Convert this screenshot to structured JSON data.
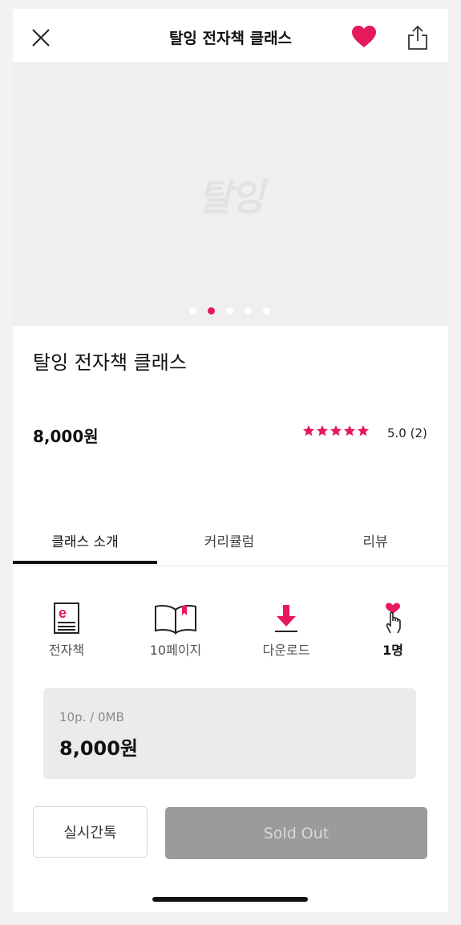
{
  "header": {
    "title": "탈잉 전자책 클래스",
    "close_icon": "close-icon",
    "like_icon": "heart-icon",
    "share_icon": "share-icon",
    "like_color": "#e6195b"
  },
  "hero": {
    "logo_text": "탈잉",
    "carousel_total": 5,
    "carousel_active": 2
  },
  "product": {
    "title": "탈잉 전자책 클래스",
    "price": "8,000원",
    "rating_stars": 5,
    "rating_text": "5.0 (2)",
    "star_color": "#e6195b"
  },
  "tabs": [
    {
      "label": "클래스 소개",
      "active": true
    },
    {
      "label": "커리큘럼",
      "active": false
    },
    {
      "label": "리뷰",
      "active": false
    }
  ],
  "features": [
    {
      "icon": "ebook-icon",
      "label": "전자책"
    },
    {
      "icon": "book-open-icon",
      "label": "10페이지"
    },
    {
      "icon": "download-icon",
      "label": "다운로드"
    },
    {
      "icon": "heart-hand-icon",
      "label": "1명"
    }
  ],
  "option_card": {
    "subtitle": "10p. / 0MB",
    "price": "8,000원"
  },
  "actions": {
    "chat_label": "실시간톡",
    "buy_label": "Sold Out"
  },
  "accent_color": "#e6195b"
}
